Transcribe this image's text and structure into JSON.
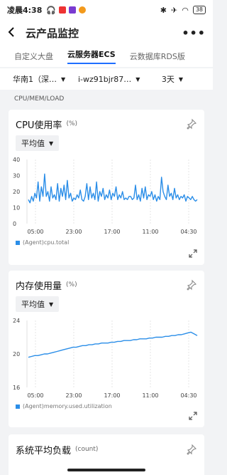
{
  "status_bar": {
    "time": "凌晨4:38",
    "battery": "38"
  },
  "nav": {
    "title": "云产品监控"
  },
  "tabs": [
    {
      "label": "自定义大盘"
    },
    {
      "label": "云服务器ECS"
    },
    {
      "label": "云数据库RDS版"
    }
  ],
  "filters": {
    "region": "华南1（深…",
    "instance": "i-wz91bjr87…",
    "range": "3天"
  },
  "section_label": "CPU/MEM/LOAD",
  "cards": [
    {
      "title": "CPU使用率",
      "unit": "(%)",
      "aggregation": "平均值",
      "legend": "(Agent)cpu.total"
    },
    {
      "title": "内存使用量",
      "unit": "(%)",
      "aggregation": "平均值",
      "legend": "(Agent)memory.used.utilization"
    },
    {
      "title": "系统平均负载",
      "unit": "(count)"
    }
  ],
  "chart_data": [
    {
      "type": "line",
      "name": "CPU使用率",
      "ylim": [
        0,
        40
      ],
      "yticks": [
        "40",
        "30",
        "20",
        "10",
        "0"
      ],
      "xticks": [
        "05:00",
        "23:00",
        "17:00",
        "11:00",
        "04:30"
      ],
      "color": "#2b8ee8",
      "values": [
        15,
        13,
        17,
        14,
        19,
        16,
        26,
        14,
        23,
        17,
        31,
        17,
        20,
        14,
        23,
        16,
        18,
        15,
        25,
        14,
        22,
        17,
        24,
        15,
        27,
        16,
        19,
        14,
        16,
        15,
        18,
        16,
        21,
        15,
        14,
        17,
        25,
        15,
        23,
        16,
        19,
        15,
        26,
        14,
        20,
        17,
        22,
        15,
        18,
        16,
        21,
        15,
        19,
        17,
        23,
        15,
        18,
        16,
        20,
        15,
        16,
        15,
        17,
        17,
        15,
        16,
        24,
        15,
        18,
        14,
        22,
        16,
        23,
        15,
        18,
        17,
        20,
        15,
        18,
        14,
        17,
        15,
        29,
        20,
        17,
        15,
        24,
        17,
        19,
        15,
        22,
        16,
        18,
        15,
        17,
        16,
        18,
        14,
        17,
        16,
        15,
        17,
        15,
        14,
        15
      ]
    },
    {
      "type": "line",
      "name": "内存使用量",
      "ylim": [
        16,
        24
      ],
      "yticks": [
        "24",
        "20",
        "16"
      ],
      "xticks": [
        "05:00",
        "23:00",
        "17:00",
        "11:00",
        "04:30"
      ],
      "color": "#2b8ee8",
      "values": [
        19.6,
        19.7,
        19.8,
        19.8,
        19.9,
        20.0,
        20.0,
        20.1,
        20.2,
        20.3,
        20.4,
        20.5,
        20.6,
        20.7,
        20.8,
        20.8,
        20.9,
        21.0,
        21.0,
        21.1,
        21.1,
        21.2,
        21.2,
        21.3,
        21.3,
        21.3,
        21.4,
        21.4,
        21.5,
        21.5,
        21.6,
        21.6,
        21.6,
        21.7,
        21.7,
        21.8,
        21.8,
        21.8,
        21.9,
        21.9,
        22.0,
        22.0,
        22.0,
        22.1,
        22.1,
        22.2,
        22.2,
        22.3,
        22.3,
        22.4,
        22.5,
        22.6,
        22.4,
        22.2
      ]
    }
  ]
}
